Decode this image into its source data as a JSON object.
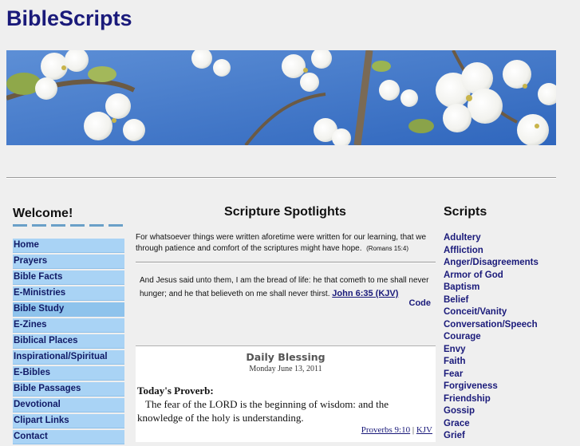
{
  "site": {
    "title": "BibleScripts"
  },
  "left": {
    "welcome": "Welcome!",
    "nav": [
      "Home",
      "Prayers",
      "Bible Facts",
      "E-Ministries",
      "Bible Study",
      "E-Zines",
      "Biblical Places",
      "Inspirational/Spiritual",
      "E-Bibles",
      "Bible Passages",
      "Devotional",
      "Clipart Links",
      "Contact"
    ]
  },
  "center": {
    "title": "Scripture Spotlights",
    "intro": "For whatsoever things were written aforetime were written for our learning, that we through patience and comfort of the scriptures might have hope.",
    "intro_ref": "(Romans 15:4)",
    "verse": "And Jesus said unto them, I am the bread of life: he that cometh to me shall never hunger; and he that believeth on me shall never thirst.",
    "verse_link": "John 6:35 (KJV)",
    "code_link": "Code",
    "blessing": {
      "title": "Daily Blessing",
      "date": "Monday June 13, 2011",
      "heading": "Today's Proverb:",
      "body": "The fear of the LORD is the beginning of wisdom: and the knowledge of the holy is understanding.",
      "ref": "Proverbs 9:10",
      "sep": " | ",
      "version": "KJV"
    }
  },
  "right": {
    "title": "Scripts",
    "items": [
      "Adultery",
      "Affliction",
      "Anger/Disagreements",
      "Armor of God",
      "Baptism",
      "Belief",
      "Conceit/Vanity",
      "Conversation/Speech",
      "Courage",
      "Envy",
      "Faith",
      "Fear",
      "Forgiveness",
      "Friendship",
      "Gossip",
      "Grace",
      "Grief"
    ]
  },
  "colors": {
    "link": "#1a1a7a",
    "nav_bg": "#a9d3f5",
    "sky": "#3a73c6"
  }
}
